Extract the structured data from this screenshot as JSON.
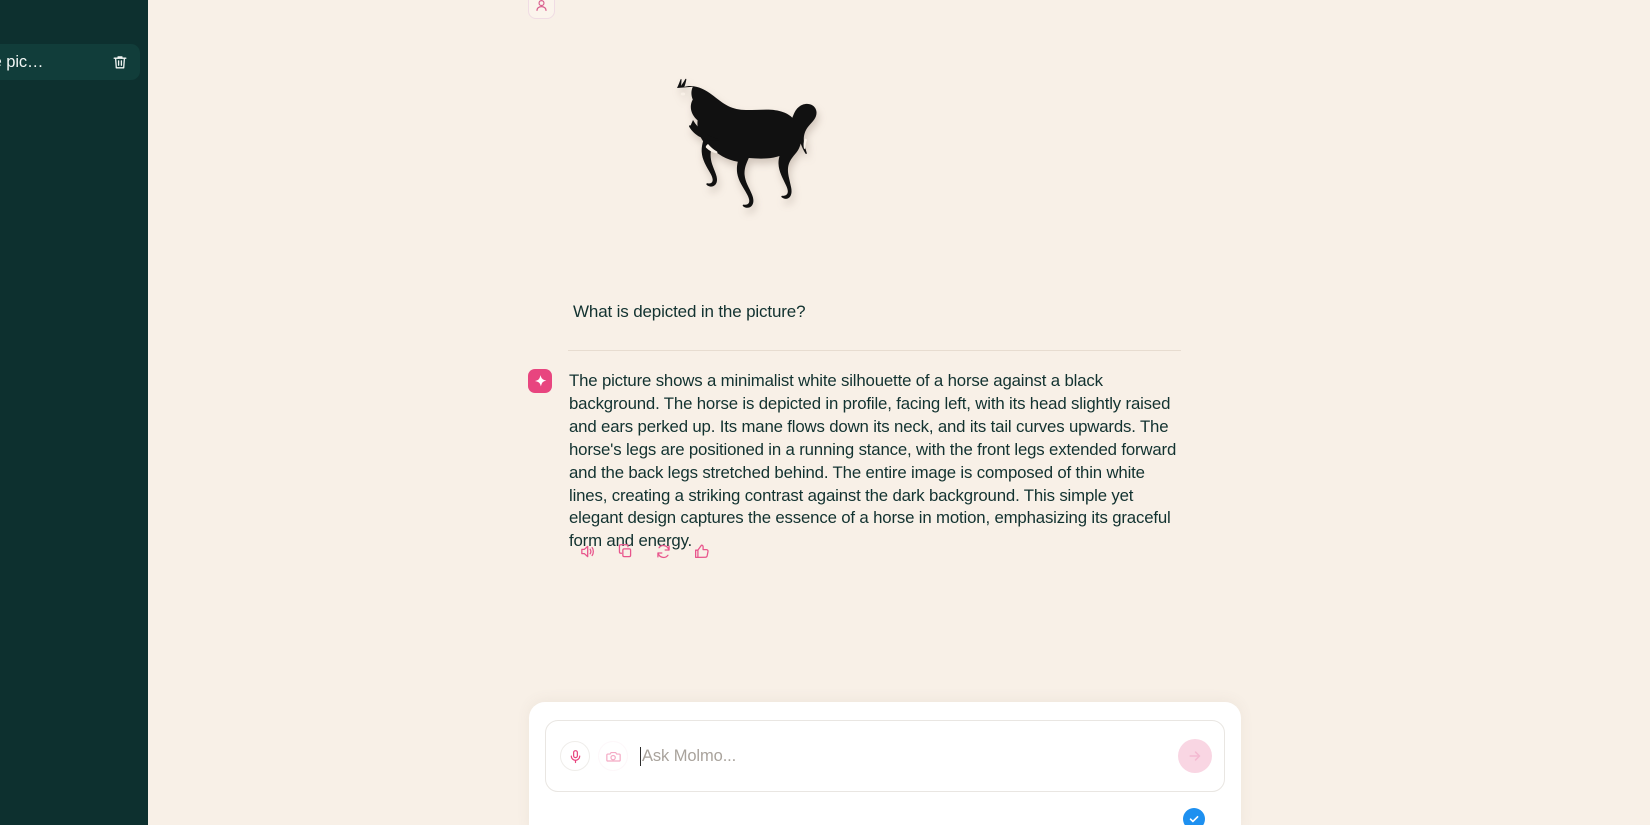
{
  "theme": {
    "sidebar_bg": "#0D302F",
    "sidebar_item_bg": "#113D3A",
    "main_bg": "#F8F0E7",
    "text_dark": "#123230",
    "accent_pink": "#E8457F",
    "accent_pink_soft": "#F9D6E3",
    "check_blue": "#1E90F0"
  },
  "sidebar": {
    "chats": [
      {
        "label": "in the pic…",
        "icon": "trash-icon",
        "active": true
      },
      {
        "label": "?",
        "icon": "",
        "active": false
      }
    ]
  },
  "conversation": {
    "user_avatar_icon": "person-icon",
    "attached_image": {
      "alt": "black horse silhouette trotting, facing left",
      "subject": "horse",
      "style": "silhouette"
    },
    "user_message": "What is depicted in the picture?",
    "assistant_avatar_icon": "sparkle-icon",
    "assistant_message": "The picture shows a minimalist white silhouette of a horse against a black background. The horse is depicted in profile, facing left, with its head slightly raised and ears perked up. Its mane flows down its neck, and its tail curves upwards. The horse's legs are positioned in a running stance, with the front legs extended forward and the back legs stretched behind. The entire image is composed of thin white lines, creating a striking contrast against the dark background. This simple yet elegant design captures the essence of a horse in motion, emphasizing its graceful form and energy.",
    "actions": [
      {
        "name": "read-aloud",
        "icon": "speaker-icon"
      },
      {
        "name": "copy",
        "icon": "copy-icon"
      },
      {
        "name": "regenerate",
        "icon": "refresh-icon"
      },
      {
        "name": "like",
        "icon": "thumbs-up-icon"
      }
    ]
  },
  "composer": {
    "mic_icon": "microphone-icon",
    "camera_icon": "camera-icon",
    "placeholder": "Ask Molmo...",
    "value": "",
    "send_icon": "arrow-right-icon",
    "status_icon": "check-icon"
  }
}
